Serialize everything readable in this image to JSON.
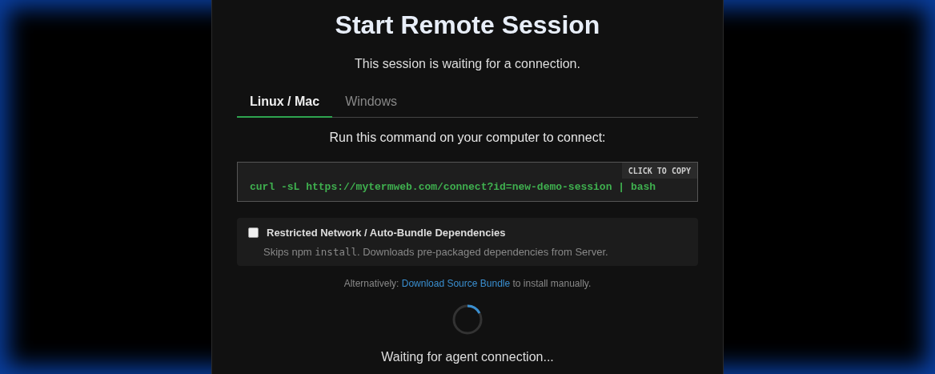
{
  "title": "Start Remote Session",
  "subtitle": "This session is waiting for a connection.",
  "tabs": [
    {
      "label": "Linux / Mac",
      "selected": true
    },
    {
      "label": "Windows",
      "selected": false
    }
  ],
  "instruction": "Run this command on your computer to connect:",
  "command": {
    "text": "curl -sL https://mytermweb.com/connect?id=new-demo-session | bash",
    "copy_label": "CLICK TO COPY"
  },
  "option": {
    "label": "Restricted Network / Auto-Bundle Dependencies",
    "checked": false,
    "description": [
      {
        "kind": "plain",
        "text": "Skips npm "
      },
      {
        "kind": "code",
        "text": "install"
      },
      {
        "kind": "plain",
        "text": ". Downloads pre-packaged dependencies from Server."
      }
    ]
  },
  "alternative": {
    "before": "Alternatively: ",
    "link": "Download Source Bundle",
    "after": " to install manually."
  },
  "status": "Waiting for agent connection..."
}
